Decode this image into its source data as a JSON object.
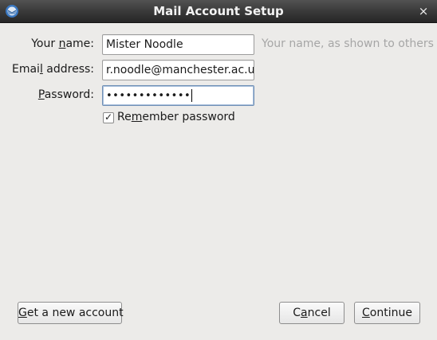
{
  "window": {
    "title": "Mail Account Setup",
    "close_glyph": "×",
    "app_icon": "thunderbird-icon"
  },
  "form": {
    "name": {
      "label_pre": "Your ",
      "label_u": "n",
      "label_post": "ame:",
      "value": "Mister Noodle",
      "hint": "Your name, as shown to others"
    },
    "email": {
      "label_pre": "Emai",
      "label_u": "l",
      "label_post": " address:",
      "value": "r.noodle@manchester.ac.uk"
    },
    "password": {
      "label_pre": "",
      "label_u": "P",
      "label_post": "assword:",
      "masked_value": "•••••••••••••"
    },
    "remember": {
      "label_pre": "Re",
      "label_u": "m",
      "label_post": "ember password",
      "checked": true,
      "check_glyph": "✓"
    }
  },
  "buttons": {
    "new_account": {
      "u": "G",
      "rest": "et a new account"
    },
    "cancel": {
      "pre": "C",
      "u": "a",
      "rest": "ncel"
    },
    "continue": {
      "u": "C",
      "rest": "ontinue"
    }
  }
}
